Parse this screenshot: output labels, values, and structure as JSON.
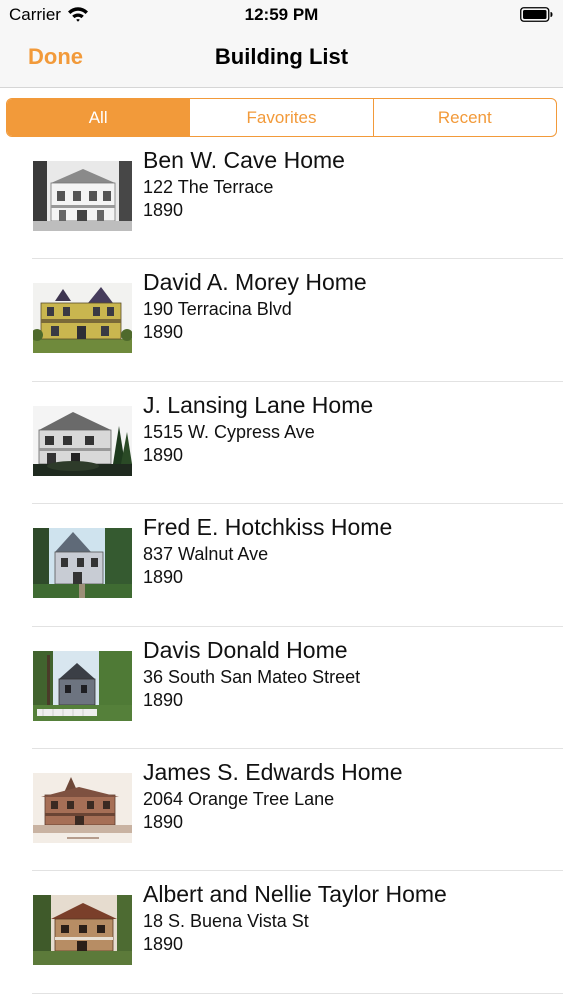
{
  "status_bar": {
    "carrier": "Carrier",
    "time": "12:59 PM"
  },
  "nav": {
    "done_label": "Done",
    "title": "Building List"
  },
  "segments": [
    {
      "label": "All",
      "selected": true
    },
    {
      "label": "Favorites",
      "selected": false
    },
    {
      "label": "Recent",
      "selected": false
    }
  ],
  "buildings": [
    {
      "name": "Ben W. Cave Home",
      "address": "122 The Terrace",
      "year": "1890"
    },
    {
      "name": "David A. Morey Home",
      "address": "190 Terracina Blvd",
      "year": "1890"
    },
    {
      "name": "J. Lansing Lane Home",
      "address": "1515 W. Cypress Ave",
      "year": "1890"
    },
    {
      "name": "Fred E. Hotchkiss Home",
      "address": "837 Walnut Ave",
      "year": "1890"
    },
    {
      "name": "Davis Donald Home",
      "address": "36 South San Mateo Street",
      "year": "1890"
    },
    {
      "name": "James S. Edwards Home",
      "address": "2064 Orange Tree Lane",
      "year": "1890"
    },
    {
      "name": "Albert and Nellie Taylor Home",
      "address": "18 S. Buena Vista St",
      "year": "1890"
    }
  ],
  "colors": {
    "accent": "#f29a3a",
    "nav_background": "#f7f7f7",
    "separator": "#e2e2e2"
  }
}
